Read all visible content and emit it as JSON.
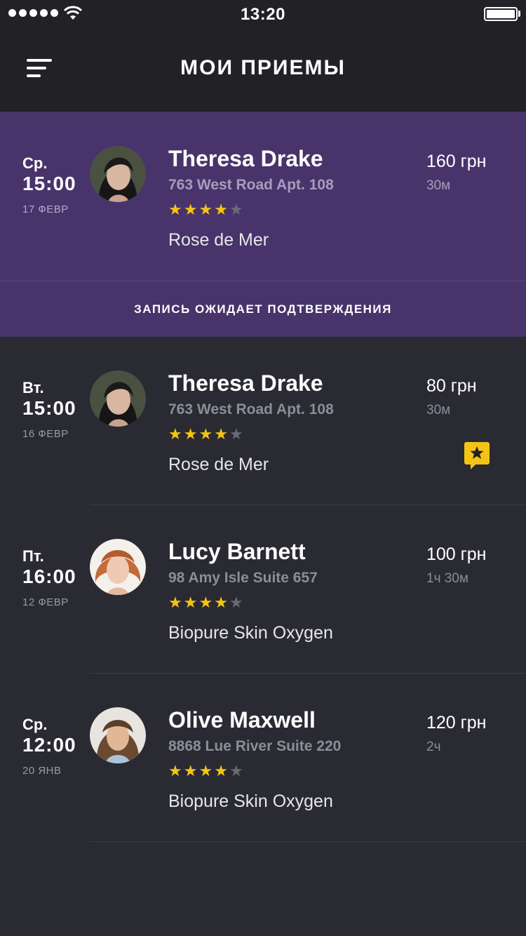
{
  "status_bar": {
    "time": "13:20"
  },
  "header": {
    "title": "МОИ ПРИЕМЫ"
  },
  "appointments": [
    {
      "day": "Ср.",
      "time": "15:00",
      "date": "17 ФЕВР",
      "name": "Theresa Drake",
      "address": "763 West Road Apt. 108",
      "rating": 4,
      "service": "Rose de Mer",
      "price": "160 грн",
      "duration": "30м",
      "status": "ЗАПИСЬ ОЖИДАЕТ ПОДТВЕРЖДЕНИЯ"
    },
    {
      "day": "Вт.",
      "time": "15:00",
      "date": "16 ФЕВР",
      "name": "Theresa Drake",
      "address": "763 West Road Apt. 108",
      "rating": 4,
      "service": "Rose de Mer",
      "price": "80 грн",
      "duration": "30м"
    },
    {
      "day": "Пт.",
      "time": "16:00",
      "date": "12 ФЕВР",
      "name": "Lucy Barnett",
      "address": "98 Amy Isle Suite 657",
      "rating": 4,
      "service": "Biopure Skin Oxygen",
      "price": "100 грн",
      "duration": "1ч 30м"
    },
    {
      "day": "Ср.",
      "time": "12:00",
      "date": "20 ЯНВ",
      "name": "Olive Maxwell",
      "address": "8868 Lue River Suite 220",
      "rating": 4,
      "service": "Biopure Skin Oxygen",
      "price": "120 грн",
      "duration": "2ч"
    }
  ],
  "colors": {
    "background": "#2a2a33",
    "header": "#222226",
    "accent_purple": "#48346b",
    "star": "#f4c414",
    "badge": "#f4c414"
  },
  "icons": [
    "menu-icon",
    "wifi-icon",
    "battery-icon",
    "star-icon",
    "review-badge-icon"
  ]
}
